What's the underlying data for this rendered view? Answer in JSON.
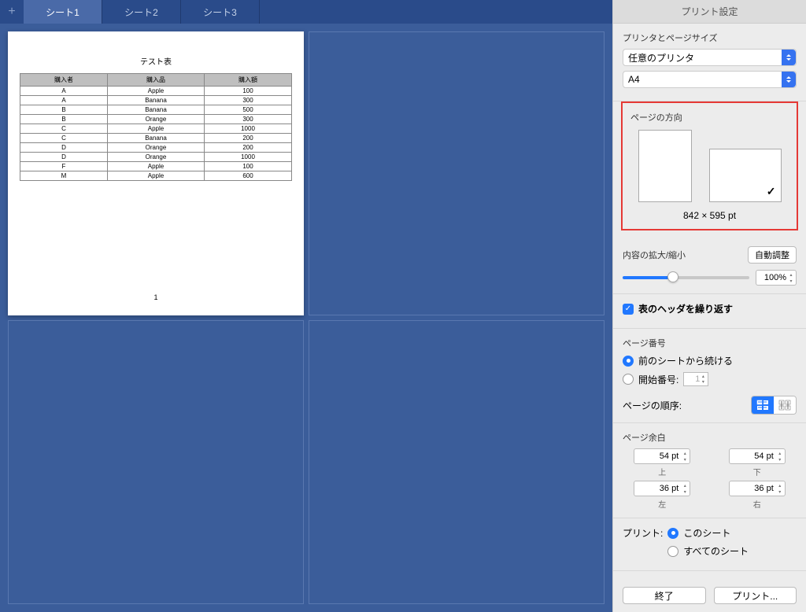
{
  "tabs": [
    "シート1",
    "シート2",
    "シート3"
  ],
  "activeTab": 0,
  "preview": {
    "title": "テスト表",
    "headers": [
      "購入者",
      "購入品",
      "購入額"
    ],
    "rows": [
      [
        "A",
        "Apple",
        "100"
      ],
      [
        "A",
        "Banana",
        "300"
      ],
      [
        "B",
        "Banana",
        "500"
      ],
      [
        "B",
        "Orange",
        "300"
      ],
      [
        "C",
        "Apple",
        "1000"
      ],
      [
        "C",
        "Banana",
        "200"
      ],
      [
        "D",
        "Orange",
        "200"
      ],
      [
        "D",
        "Orange",
        "1000"
      ],
      [
        "F",
        "Apple",
        "100"
      ],
      [
        "M",
        "Apple",
        "600"
      ]
    ],
    "pageNumber": "1"
  },
  "panel": {
    "title": "プリント設定",
    "printerSizeLabel": "プリンタとページサイズ",
    "printer": "任意のプリンタ",
    "paperSize": "A4",
    "orientationLabel": "ページの方向",
    "orientationSize": "842 × 595 pt",
    "scaleLabel": "内容の拡大/縮小",
    "autoFit": "自動調整",
    "scaleValue": "100%",
    "repeatHeaderLabel": "表のヘッダを繰り返す",
    "pageNumberLabel": "ページ番号",
    "continueFromPrev": "前のシートから続ける",
    "startNumberLabel": "開始番号:",
    "startNumber": "1",
    "pageOrderLabel": "ページの順序:",
    "marginsLabel": "ページ余白",
    "margins": {
      "topValue": "54 pt",
      "topLabel": "上",
      "bottomValue": "54 pt",
      "bottomLabel": "下",
      "leftValue": "36 pt",
      "leftLabel": "左",
      "rightValue": "36 pt",
      "rightLabel": "右"
    },
    "printLabel": "プリント:",
    "printThisSheet": "このシート",
    "printAllSheets": "すべてのシート",
    "doneButton": "終了",
    "printButton": "プリント..."
  }
}
